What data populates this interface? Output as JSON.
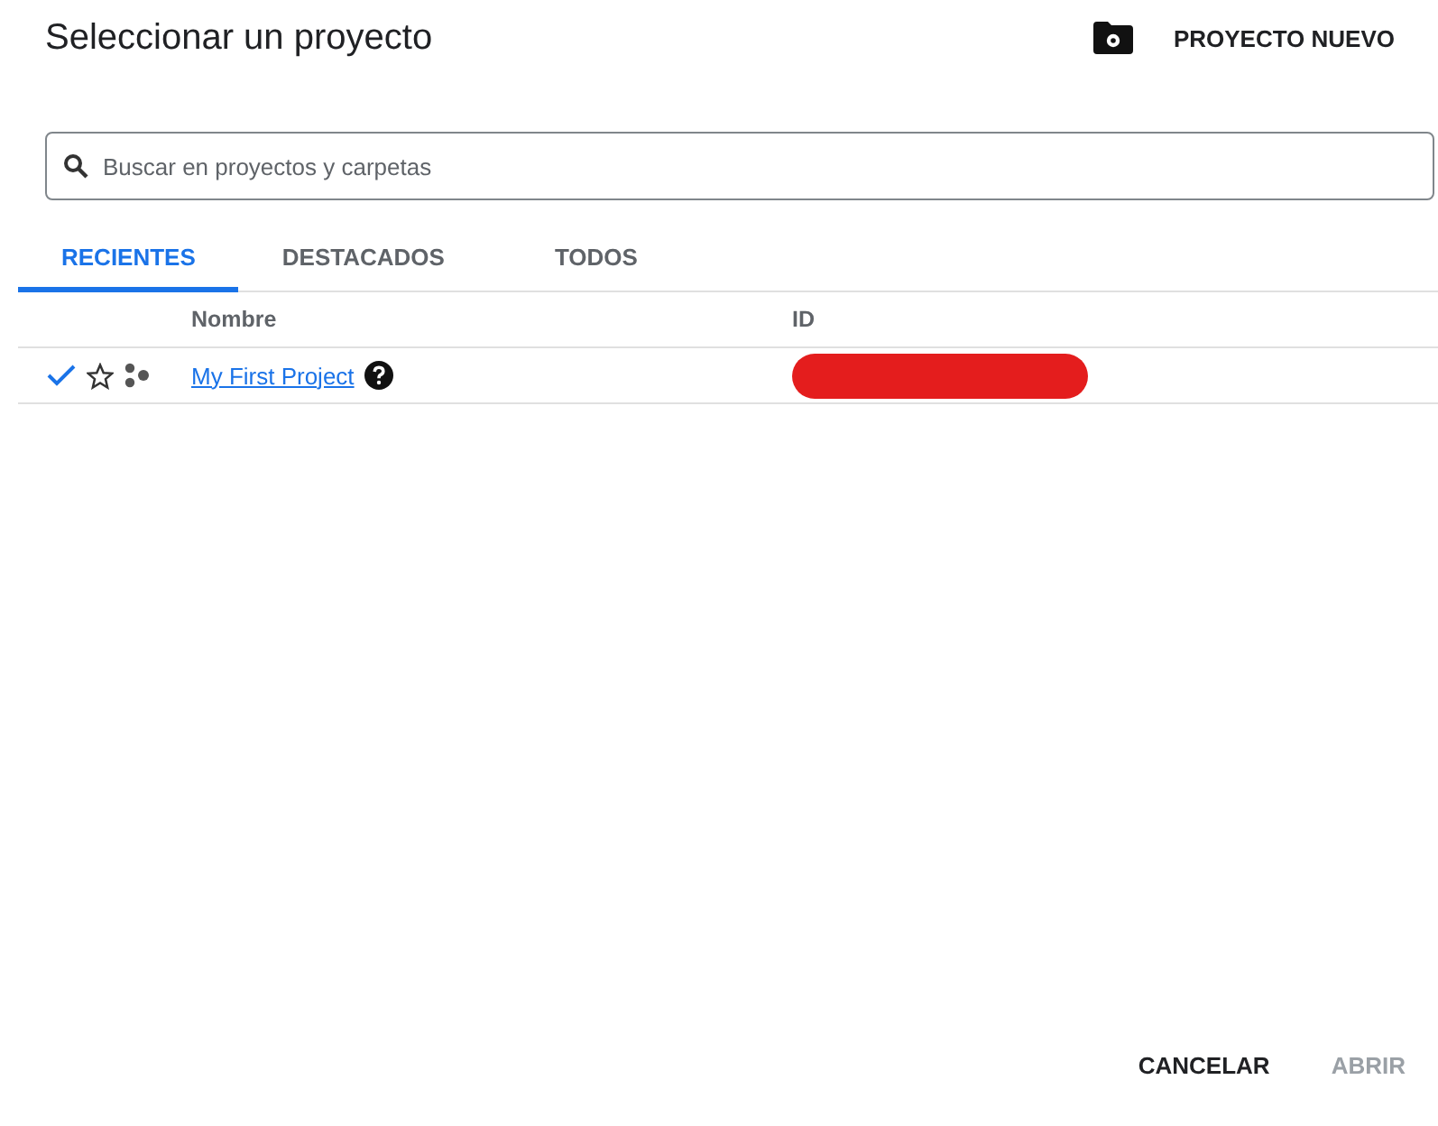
{
  "dialog": {
    "title": "Seleccionar un proyecto",
    "new_project_button": "PROYECTO NUEVO"
  },
  "search": {
    "placeholder": "Buscar en proyectos y carpetas"
  },
  "tabs": [
    {
      "label": "RECIENTES",
      "selected": true
    },
    {
      "label": "DESTACADOS",
      "selected": false
    },
    {
      "label": "TODOS",
      "selected": false
    }
  ],
  "table": {
    "columns": [
      "Nombre",
      "ID"
    ],
    "rows": [
      {
        "name": "My First Project",
        "selected": true,
        "starred": false
      }
    ]
  },
  "buttons": [
    {
      "label": "CANCELAR",
      "disabled": false
    },
    {
      "label": "ABRIR",
      "disabled": true
    }
  ]
}
